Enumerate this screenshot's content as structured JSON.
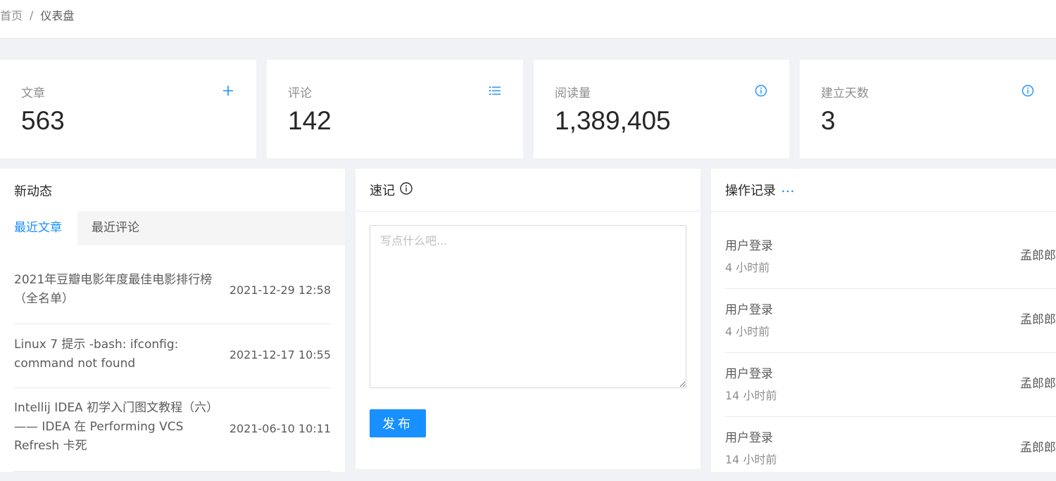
{
  "breadcrumb": {
    "home": "首页",
    "separator": "/",
    "current": "仪表盘"
  },
  "stats": [
    {
      "label": "文章",
      "value": "563",
      "icon": "plus-icon"
    },
    {
      "label": "评论",
      "value": "142",
      "icon": "list-icon"
    },
    {
      "label": "阅读量",
      "value": "1,389,405",
      "icon": "info-icon"
    },
    {
      "label": "建立天数",
      "value": "3",
      "icon": "info-icon"
    }
  ],
  "activity": {
    "title": "新动态",
    "tabs": [
      "最近文章",
      "最近评论"
    ],
    "posts": [
      {
        "title": "2021年豆瓣电影年度最佳电影排行榜（全名单）",
        "date": "2021-12-29 12:58"
      },
      {
        "title": "Linux 7 提示 -bash: ifconfig: command not found",
        "date": "2021-12-17 10:55"
      },
      {
        "title": "Intellij IDEA 初学入门图文教程（六） —— IDEA 在 Performing VCS Refresh 卡死",
        "date": "2021-06-10 10:11"
      }
    ]
  },
  "note": {
    "title": "速记",
    "placeholder": "写点什么吧...",
    "publish_label": "发布"
  },
  "logs": {
    "title": "操作记录",
    "items": [
      {
        "action": "用户登录",
        "time": "4 小时前",
        "user": "孟郎郎"
      },
      {
        "action": "用户登录",
        "time": "4 小时前",
        "user": "孟郎郎"
      },
      {
        "action": "用户登录",
        "time": "14 小时前",
        "user": "孟郎郎"
      },
      {
        "action": "用户登录",
        "time": "14 小时前",
        "user": "孟郎郎"
      }
    ]
  },
  "colors": {
    "accent": "#1890ff",
    "background": "#f0f2f5",
    "card": "#ffffff"
  }
}
